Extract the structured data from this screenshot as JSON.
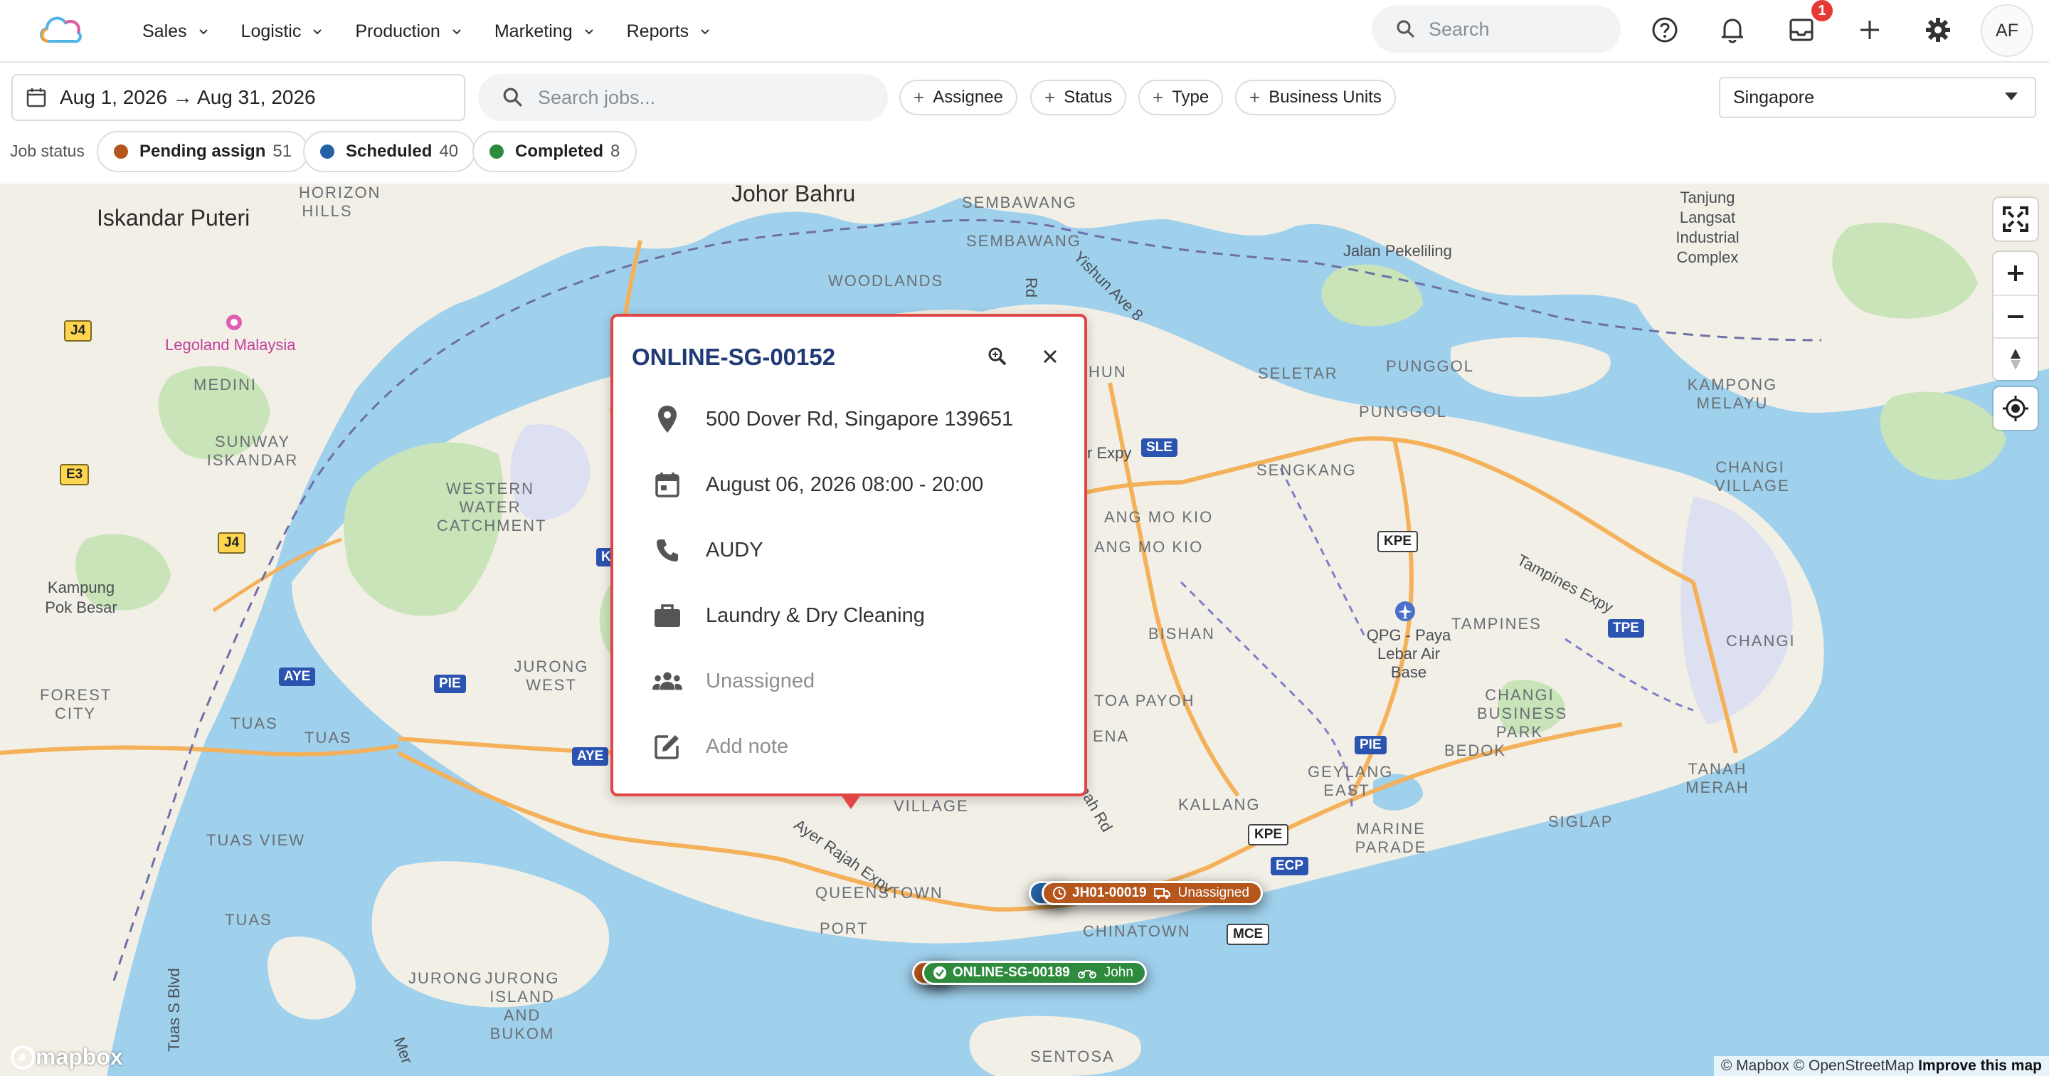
{
  "nav": {
    "items": [
      {
        "label": "Sales"
      },
      {
        "label": "Logistic"
      },
      {
        "label": "Production"
      },
      {
        "label": "Marketing"
      },
      {
        "label": "Reports"
      }
    ],
    "search_placeholder": "Search",
    "notification_badge": "1",
    "avatar_initials": "AF"
  },
  "filters": {
    "date_range": "Aug 1, 2026 → Aug 31, 2026",
    "job_search_placeholder": "Search jobs...",
    "chips": [
      "Assignee",
      "Status",
      "Type",
      "Business Units"
    ],
    "region": "Singapore"
  },
  "job_status": {
    "label": "Job status",
    "items": [
      {
        "label": "Pending assign",
        "count": "51",
        "color": "#b5561c"
      },
      {
        "label": "Scheduled",
        "count": "40",
        "color": "#2563a8"
      },
      {
        "label": "Completed",
        "count": "8",
        "color": "#2e8b3e"
      }
    ]
  },
  "map": {
    "labels": {
      "johor_bahru": "Johor Bahru",
      "iskandar_puteri": "Iskandar Puteri",
      "horizon_hills": "HORIZON HILLS",
      "legoland": "Legoland Malaysia",
      "medini": "MEDINI",
      "sunway_iskandar": "SUNWAY ISKANDAR",
      "kampung_pok_besar": "Kampung Pok Besar",
      "western_water": "WESTERN WATER CATCHMENT",
      "jurong_west": "JURONG WEST",
      "forest_city": "FOREST CITY",
      "tuas": "TUAS",
      "tuas2": "TUAS",
      "tuas_view": "TUAS VIEW",
      "jurong_island": "JURONG ISLAND AND BUKOM",
      "jurong": "JURONG",
      "sembawang": "SEMBAWANG",
      "sembawang2": "SEMBAWANG",
      "woodlands": "WOODLANDS",
      "yishun_ave": "Yishun Ave 8",
      "seletar": "SELETAR",
      "punggol": "PUNGGOL",
      "punggol2": "PUNGGOL",
      "sengkang": "SENGKANG",
      "jalan_pekeliling": "Jalan Pekeliling",
      "tanjung_langsat": "Tanjung Langsat Industrial Complex",
      "kampong_melayu": "KAMPONG MELAYU",
      "changi_village": "CHANGI VILLAGE",
      "tampines_expy": "Tampines Expy",
      "tampines": "TAMPINES",
      "changi": "CHANGI",
      "changi_business": "CHANGI BUSINESS PARK",
      "qpg": "QPG - Paya Lebar Air Base",
      "bishan": "BISHAN",
      "toa_payoh": "TOA PAYOH",
      "ang_mo_kio": "ANG MO KIO",
      "ang_mo_kio2": "ANG MO KIO",
      "hun": "HUN",
      "bedok": "BEDOK",
      "tanah_merah": "TANAH MERAH",
      "siglap": "SIGLAP",
      "geylang_east": "GEYLANG EAST",
      "kallang": "KALLANG",
      "marine_parade": "MARINE PARADE",
      "village": "VILLAGE",
      "ayer_rajah": "Ayer Rajah Expy",
      "queenstown": "QUEENSTOWN",
      "port": "PORT",
      "chinatown": "CHINATOWN",
      "sentosa": "SENTOSA",
      "tuas_s_blvd": "Tuas S Blvd",
      "expy": "r Expy",
      "ena": "ENA",
      "mah_rd": "mah Rd",
      "rd": "Rd",
      "mer": "Mer"
    },
    "shields": {
      "sle": "SLE",
      "kpe": "KPE",
      "kpe2": "KPE",
      "tpe": "TPE",
      "pie": "PIE",
      "pie2": "PIE",
      "aye": "AYE",
      "aye2": "AYE",
      "ecp": "ECP",
      "mce": "MCE",
      "j4": "J4",
      "j4b": "J4",
      "e3": "E3",
      "k": "K"
    },
    "attribution_pre": "© Mapbox © OpenStreetMap",
    "attribution_link": "Improve this map",
    "logo_text": "mapbox"
  },
  "markers": [
    {
      "id": "JH01-00019",
      "sub": "Unassigned",
      "color": "#b5561c"
    },
    {
      "id": "ONLINE-SG-00189",
      "sub": "John",
      "color": "#2e8b3e"
    }
  ],
  "popup": {
    "title": "ONLINE-SG-00152",
    "address": "500 Dover Rd, Singapore 139651",
    "datetime": "August 06, 2026 08:00 - 20:00",
    "contact": "AUDY",
    "service": "Laundry & Dry Cleaning",
    "assignee": "Unassigned",
    "note_placeholder": "Add note"
  }
}
